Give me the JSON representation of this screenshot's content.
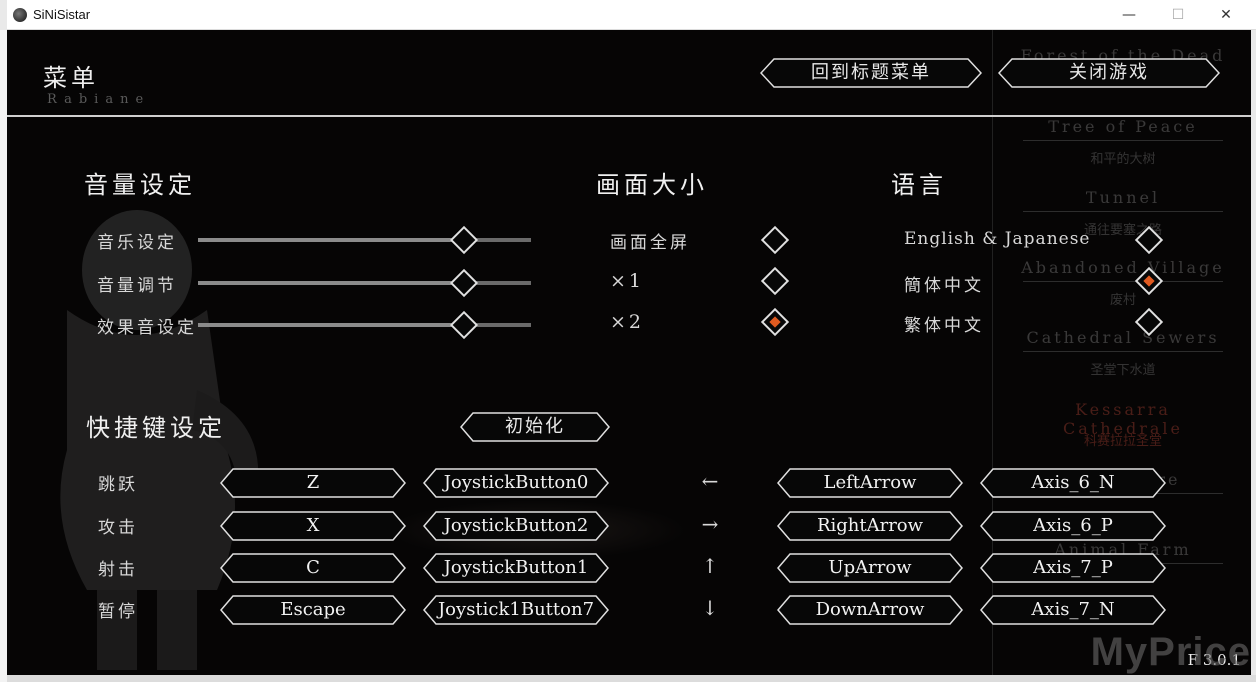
{
  "window": {
    "title": "SiNiSistar",
    "minimize": "—",
    "maximize": "☐",
    "close": "✕"
  },
  "menu": {
    "title": "菜单",
    "subtitle": "Rabiane",
    "back_to_title": "回到标题菜单",
    "close_game": "关闭游戏"
  },
  "volume": {
    "title": "音量设定",
    "rows": [
      {
        "label": "音乐设定",
        "level": 0.8
      },
      {
        "label": "音量调节",
        "level": 0.8
      },
      {
        "label": "效果音设定",
        "level": 0.8
      }
    ]
  },
  "screen": {
    "title": "画面大小",
    "options": [
      {
        "label": "画面全屏",
        "selected": false
      },
      {
        "label": "×1",
        "selected": false
      },
      {
        "label": "×2",
        "selected": true
      }
    ]
  },
  "language": {
    "title": "语言",
    "options": [
      {
        "label": "English & Japanese",
        "selected": false
      },
      {
        "label": "簡体中文",
        "selected": true
      },
      {
        "label": "繁体中文",
        "selected": false
      }
    ]
  },
  "shortcuts": {
    "title": "快捷键设定",
    "reset": "初始化",
    "rows": [
      {
        "action": "跳跃",
        "key": "Z",
        "joy": "JoystickButton0",
        "arrow": "←",
        "dir": "LeftArrow",
        "axis": "Axis_6_N"
      },
      {
        "action": "攻击",
        "key": "X",
        "joy": "JoystickButton2",
        "arrow": "→",
        "dir": "RightArrow",
        "axis": "Axis_6_P"
      },
      {
        "action": "射击",
        "key": "C",
        "joy": "JoystickButton1",
        "arrow": "↑",
        "dir": "UpArrow",
        "axis": "Axis_7_P"
      },
      {
        "action": "暂停",
        "key": "Escape",
        "joy": "Joystick1Button7",
        "arrow": "↓",
        "dir": "DownArrow",
        "axis": "Axis_7_N"
      }
    ]
  },
  "map_bg": {
    "items": [
      {
        "name": "Forest of the Dead",
        "sub": ""
      },
      {
        "name": "Tree of Peace",
        "sub": "和平的大树"
      },
      {
        "name": "Tunnel",
        "sub": "通往要塞之路"
      },
      {
        "name": "Abandoned Village",
        "sub": "废村"
      },
      {
        "name": "Cathedral Sewers",
        "sub": "圣堂下水道"
      },
      {
        "name": "Kessarra Cathedrale",
        "sub": "科赛拉拉圣堂"
      },
      {
        "name": "Nightmare",
        "sub": ""
      },
      {
        "name": "Animal Farm",
        "sub": ""
      }
    ]
  },
  "version": "F 3.0.1",
  "watermark": "MyPrice"
}
